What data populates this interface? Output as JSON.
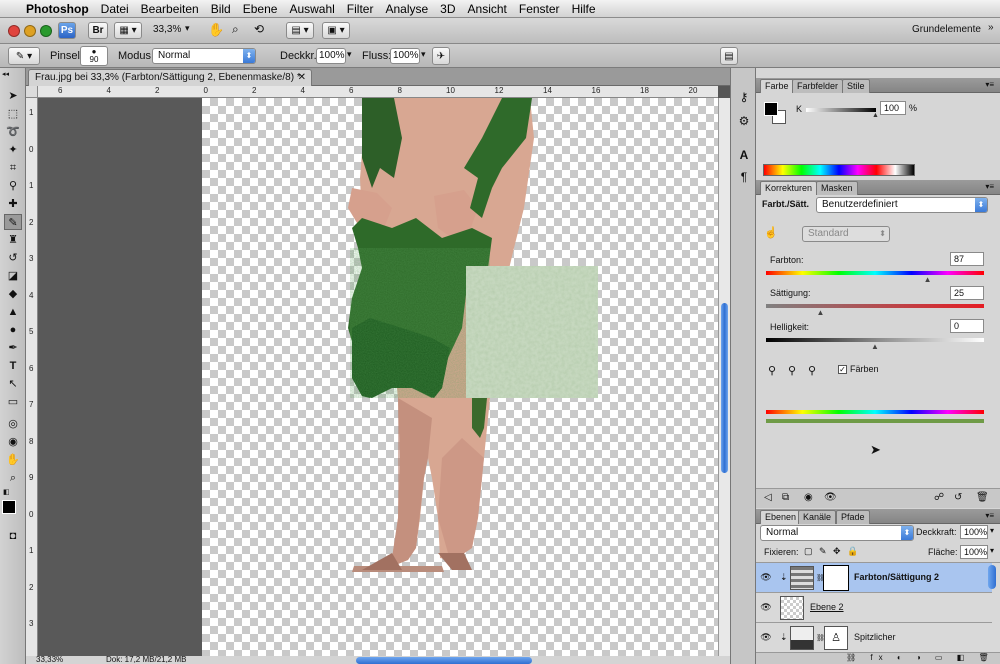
{
  "menubar": {
    "app_name": "Photoshop",
    "items": [
      "Datei",
      "Bearbeiten",
      "Bild",
      "Ebene",
      "Auswahl",
      "Filter",
      "Analyse",
      "3D",
      "Ansicht",
      "Fenster",
      "Hilfe"
    ]
  },
  "appbar": {
    "ps_badge": "Ps",
    "br_badge": "Br",
    "zoom": "33,3%",
    "workspace": "Grundelemente"
  },
  "options": {
    "brush_label": "Pinsel:",
    "brush_size": "90",
    "mode_label": "Modus:",
    "mode_value": "Normal",
    "opacity_label": "Deckkr.:",
    "opacity_value": "100%",
    "flow_label": "Fluss:",
    "flow_value": "100%"
  },
  "document": {
    "tab_title": "Frau.jpg bei 33,3% (Farbton/Sättigung 2, Ebenenmaske/8) *",
    "ruler_h": [
      "6",
      "4",
      "2",
      "0",
      "2",
      "4",
      "6",
      "8",
      "10",
      "12",
      "14",
      "16",
      "18",
      "20"
    ],
    "ruler_v": [
      "1",
      "0",
      "1",
      "2",
      "3",
      "4",
      "5",
      "6",
      "7",
      "8",
      "9",
      "0",
      "1",
      "2",
      "3"
    ],
    "status_zoom": "33,33%",
    "status_doc": "Dok: 17,2 MB/21,2 MB"
  },
  "color_panel": {
    "tabs": [
      "Farbe",
      "Farbfelder",
      "Stile"
    ],
    "channel": "K",
    "value": "100",
    "unit": "%",
    "level": 1.0
  },
  "adjust_panel": {
    "tabs": [
      "Korrekturen",
      "Masken"
    ],
    "label": "Farbt./Sätt.",
    "preset": "Benutzerdefiniert",
    "channel": "Standard",
    "hue_label": "Farbton:",
    "hue_value": "87",
    "sat_label": "Sättigung:",
    "sat_value": "25",
    "light_label": "Helligkeit:",
    "light_value": "0",
    "colorize_label": "Färben",
    "colorize_checked": true
  },
  "layers_panel": {
    "tabs": [
      "Ebenen",
      "Kanäle",
      "Pfade"
    ],
    "blend": "Normal",
    "opacity_label": "Deckkraft:",
    "opacity_value": "100%",
    "lock_label": "Fixieren:",
    "fill_label": "Fläche:",
    "fill_value": "100%",
    "layers": [
      {
        "name": "Farbton/Sättigung 2",
        "selected": true
      },
      {
        "name": "Ebene 2",
        "selected": false
      },
      {
        "name": "Spitzlicher",
        "selected": false
      }
    ]
  },
  "colors": {
    "accent_blue": "#3b7ad8",
    "selection": "#a9c5ef",
    "leaf_green": "#2f6e2a"
  }
}
